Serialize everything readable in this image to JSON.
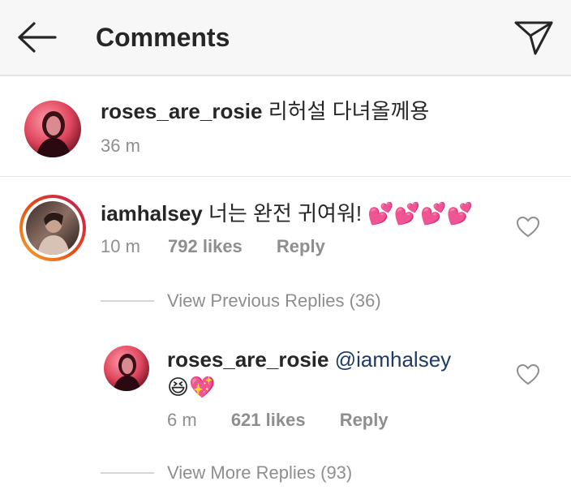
{
  "header": {
    "title": "Comments",
    "back_icon": "arrow-left-icon",
    "share_icon": "paper-plane-icon"
  },
  "caption": {
    "username": "roses_are_rosie",
    "text": "리허설 다녀올께용",
    "time": "36 m"
  },
  "comments": [
    {
      "username": "iamhalsey",
      "text": "너는 완전 귀여워!",
      "emoji": "💕💕💕💕",
      "time": "10 m",
      "likes": "792 likes",
      "reply_label": "Reply",
      "has_story_ring": true
    }
  ],
  "view_previous": "View Previous Replies (36)",
  "replies": [
    {
      "username": "roses_are_rosie",
      "mention": "@iamhalsey",
      "emoji": "😆💖",
      "time": "6 m",
      "likes": "621 likes",
      "reply_label": "Reply"
    }
  ],
  "view_more": "View More Replies (93)",
  "colors": {
    "header_bg": "#f7f7f7",
    "text": "#262626",
    "secondary": "#8e8e8e",
    "mention": "#1e3a66",
    "story_ring_start": "#f9a825",
    "story_ring_end": "#c2185b"
  }
}
